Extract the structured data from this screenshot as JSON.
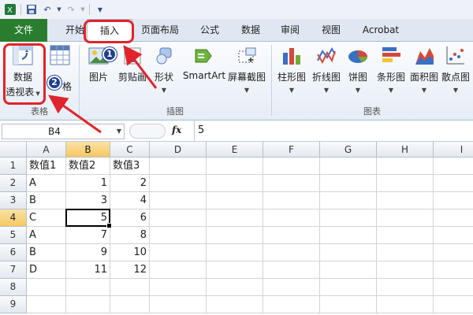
{
  "ribbon_tabs": [
    "文件",
    "开始",
    "插入",
    "页面布局",
    "公式",
    "数据",
    "审阅",
    "视图",
    "Acrobat"
  ],
  "ribbon": {
    "table_group": {
      "pivot_line1": "数据",
      "pivot_line2": "透视表",
      "table_label_partial": "格",
      "group_label": "表格"
    },
    "illustrations_group": {
      "picture": "图片",
      "clipart": "剪贴画",
      "shapes": "形状",
      "smartart": "SmartArt",
      "screenshot": "屏幕截图",
      "group_label": "插图"
    },
    "charts_group": {
      "column": "柱形图",
      "line": "折线图",
      "pie": "饼图",
      "bar": "条形图",
      "area": "面积图",
      "scatter": "散点图",
      "group_label": "图表"
    }
  },
  "formula_bar": {
    "name_box": "B4",
    "fx": "fx",
    "value": "5"
  },
  "sheet": {
    "columns": [
      "A",
      "B",
      "C",
      "D",
      "E",
      "F",
      "G",
      "H",
      "I"
    ],
    "rows": [
      "1",
      "2",
      "3",
      "4",
      "5",
      "6",
      "7",
      "8",
      "9"
    ],
    "cells": [
      [
        "数值1",
        "数值2",
        "数值3"
      ],
      [
        "A",
        "1",
        "2"
      ],
      [
        "B",
        "3",
        "4"
      ],
      [
        "C",
        "5",
        "6"
      ],
      [
        "A",
        "7",
        "8"
      ],
      [
        "B",
        "9",
        "10"
      ],
      [
        "D",
        "11",
        "12"
      ]
    ],
    "active_cell": "B4"
  },
  "annotations": {
    "badge1": "1",
    "badge2": "2"
  },
  "colors": {
    "file_tab": "#2a7d2f",
    "annotation_red": "#e0242b",
    "badge_blue": "#1f3f8f",
    "selected_header": "#f6c85f"
  }
}
